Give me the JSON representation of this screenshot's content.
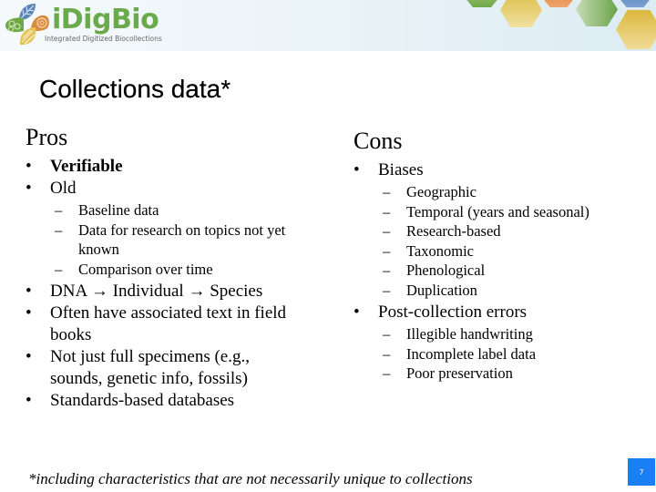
{
  "header": {
    "logo": {
      "wordmark": "iDigBio",
      "tagline": "Integrated Digitized Biocollections",
      "colors": {
        "wordmark": "#6aaa4c",
        "petal_blue": "#5b86b8",
        "petal_green": "#6fa845",
        "petal_orange": "#d98a3c",
        "petal_yellow": "#e2c45a"
      }
    },
    "hexagon_colors": [
      "#7fb15a",
      "#e6cf76",
      "#e3894a",
      "#8bbd6a",
      "#6a91c3",
      "#e3c75e"
    ]
  },
  "slide": {
    "title": "Collections data*",
    "pros": {
      "heading": "Pros",
      "items": [
        {
          "text": "Verifiable",
          "bold": true,
          "sub": []
        },
        {
          "text": "Old",
          "bold": false,
          "sub": [
            "Baseline data",
            "Data for research on topics not yet known",
            "Comparison over time"
          ]
        },
        {
          "text": "DNA → Individual → Species",
          "bold": false,
          "sub": []
        },
        {
          "text": "Often have associated text in field books",
          "bold": false,
          "sub": []
        },
        {
          "text": "Not just full specimens (e.g., sounds, genetic info, fossils)",
          "bold": false,
          "sub": []
        },
        {
          "text": "Standards-based databases",
          "bold": false,
          "sub": []
        }
      ]
    },
    "cons": {
      "heading": "Cons",
      "items": [
        {
          "text": "Biases",
          "bold": false,
          "sub": [
            "Geographic",
            "Temporal (years and seasonal)",
            "Research-based",
            "Taxonomic",
            "Phenological",
            "Duplication"
          ]
        },
        {
          "text": "Post-collection errors",
          "bold": false,
          "sub": [
            "Illegible handwriting",
            "Incomplete label data",
            "Poor preservation"
          ]
        }
      ]
    },
    "footnote": "*including characteristics that are not necessarily unique to collections",
    "page_number": "7",
    "bullet_glyph": "•",
    "dash_glyph": "–",
    "page_badge_color": "#1a7ef5"
  }
}
